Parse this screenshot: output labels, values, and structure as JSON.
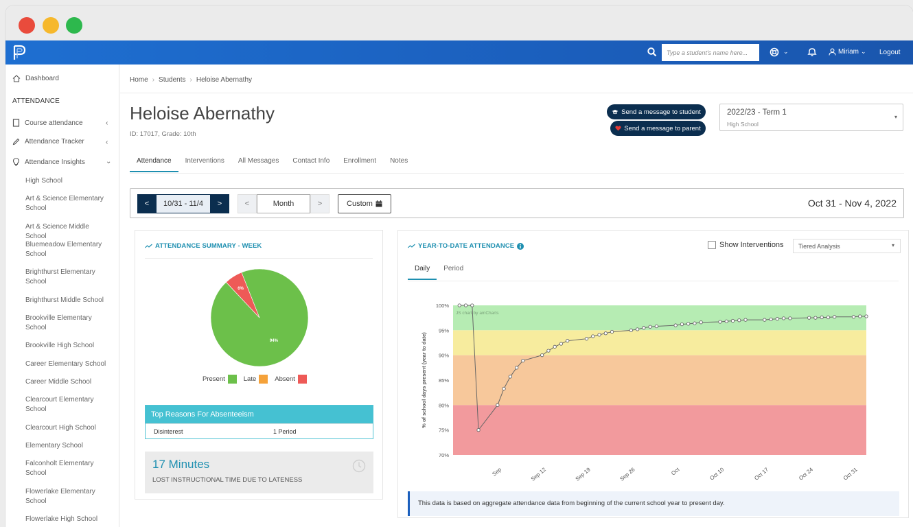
{
  "topnav": {
    "search_placeholder": "Type a student's name here...",
    "user_name": "Miriam",
    "logout_label": "Logout"
  },
  "sidebar": {
    "dashboard_label": "Dashboard",
    "section_label": "ATTENDANCE",
    "items": [
      {
        "label": "Course attendance",
        "icon": "square-icon"
      },
      {
        "label": "Attendance Tracker",
        "icon": "pencil-icon"
      },
      {
        "label": "Attendance Insights",
        "icon": "lightbulb-icon"
      }
    ],
    "schools": [
      "High School",
      "Art & Science Elementary School",
      "Art & Science Middle School",
      "Bluemeadow Elementary School",
      "Brighthurst Elementary School",
      "Brighthurst Middle School",
      "Brookville Elementary School",
      "Brookville High School",
      "Career Elementary School",
      "Career Middle School",
      "Clearcourt Elementary School",
      "Clearcourt High School",
      "Elementary School",
      "Falconholt Elementary School",
      "Flowerlake Elementary School",
      "Flowerlake High School"
    ]
  },
  "breadcrumb": [
    "Home",
    "Students",
    "Heloise Abernathy"
  ],
  "student": {
    "name": "Heloise Abernathy",
    "meta": "ID: 17017, Grade: 10th"
  },
  "actions": {
    "message_student": "Send a message to student",
    "message_parent": "Send a message to parent"
  },
  "term": {
    "value": "2022/23 - Term 1",
    "sub": "High School"
  },
  "tabs": [
    "Attendance",
    "Interventions",
    "All Messages",
    "Contact Info",
    "Enrollment",
    "Notes"
  ],
  "datebar": {
    "prev": "<",
    "range": "10/31 - 11/4",
    "next": ">",
    "month_prev": "<",
    "month": "Month",
    "month_next": ">",
    "custom": "Custom",
    "display": "Oct 31 - Nov 4, 2022"
  },
  "summary": {
    "title": "ATTENDANCE SUMMARY - WEEK",
    "legend": [
      "Present",
      "Late",
      "Absent"
    ],
    "colors": {
      "present": "#6cc04a",
      "late": "#f5a23a",
      "absent": "#ee5a57"
    }
  },
  "reasons": {
    "title": "Top Reasons For Absenteeism",
    "rows": [
      {
        "reason": "Disinterest",
        "count": "1 Period"
      }
    ]
  },
  "lateness": {
    "value": "17 Minutes",
    "label": "LOST INSTRUCTIONAL TIME DUE TO LATENESS"
  },
  "ytd": {
    "title": "YEAR-TO-DATE ATTENDANCE",
    "show_interventions": "Show Interventions",
    "analysis_select": "Tiered Analysis",
    "subtabs": [
      "Daily",
      "Period"
    ],
    "credit": "JS chart by amCharts",
    "note": "This data is based on aggregate attendance data from beginning of the current school year to present day."
  },
  "chart_data": [
    {
      "type": "pie",
      "categories": [
        "Present",
        "Late",
        "Absent"
      ],
      "values": [
        94,
        0,
        6
      ],
      "labels": [
        "94%",
        "",
        "6%"
      ]
    },
    {
      "type": "line",
      "ylabel": "% of school days present (year to date)",
      "ylim": [
        70,
        100
      ],
      "yticks": [
        "70%",
        "75%",
        "80%",
        "85%",
        "90%",
        "95%",
        "100%"
      ],
      "xticks": [
        "Sep",
        "Sep 12",
        "Sep 19",
        "Sep 26",
        "Oct",
        "Oct 10",
        "Oct 17",
        "Oct 24",
        "Oct 31"
      ],
      "bands": [
        {
          "from": 95,
          "to": 100,
          "color": "#b6ecb3"
        },
        {
          "from": 90,
          "to": 95,
          "color": "#f7ec9e"
        },
        {
          "from": 80,
          "to": 90,
          "color": "#f7c89b"
        },
        {
          "from": 70,
          "to": 80,
          "color": "#f29a9d"
        }
      ],
      "series": [
        {
          "x": [
            "2022-08-30",
            "2022-08-31",
            "2022-09-01",
            "2022-09-02",
            "2022-09-05",
            "2022-09-06",
            "2022-09-07",
            "2022-09-08",
            "2022-09-09",
            "2022-09-12",
            "2022-09-13",
            "2022-09-14",
            "2022-09-15",
            "2022-09-16",
            "2022-09-19",
            "2022-09-20",
            "2022-09-21",
            "2022-09-22",
            "2022-09-23",
            "2022-09-26",
            "2022-09-27",
            "2022-09-28",
            "2022-09-29",
            "2022-09-30",
            "2022-10-03",
            "2022-10-04",
            "2022-10-05",
            "2022-10-06",
            "2022-10-07",
            "2022-10-10",
            "2022-10-11",
            "2022-10-12",
            "2022-10-13",
            "2022-10-14",
            "2022-10-17",
            "2022-10-18",
            "2022-10-19",
            "2022-10-20",
            "2022-10-21",
            "2022-10-24",
            "2022-10-25",
            "2022-10-26",
            "2022-10-27",
            "2022-10-28",
            "2022-10-31",
            "2022-11-01",
            "2022-11-02"
          ],
          "values": [
            100,
            100,
            100,
            75,
            80,
            83.3,
            85.7,
            87.5,
            88.9,
            90.0,
            90.9,
            91.7,
            92.3,
            92.9,
            93.3,
            93.8,
            94.1,
            94.4,
            94.7,
            95.0,
            95.2,
            95.5,
            95.7,
            95.8,
            96.0,
            96.2,
            96.3,
            96.4,
            96.6,
            96.7,
            96.8,
            96.9,
            97.0,
            97.1,
            97.1,
            97.2,
            97.3,
            97.4,
            97.4,
            97.5,
            97.5,
            97.6,
            97.6,
            97.7,
            97.7,
            97.8,
            97.8
          ]
        }
      ]
    }
  ]
}
